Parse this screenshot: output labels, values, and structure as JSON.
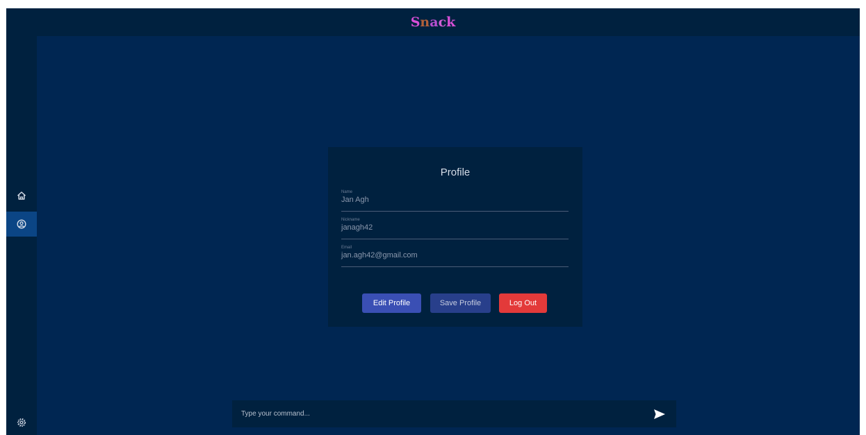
{
  "app": {
    "title_letters": [
      {
        "char": "S",
        "color": "#d94fd8"
      },
      {
        "char": "n",
        "color": "#b0603a"
      },
      {
        "char": "a",
        "color": "#b84fd0"
      },
      {
        "char": "c",
        "color": "#d15fd6"
      },
      {
        "char": "k",
        "color": "#d94fd8"
      }
    ]
  },
  "sidebar": {
    "items": [
      {
        "icon": "home-icon",
        "active": false
      },
      {
        "icon": "profile-icon",
        "active": true
      }
    ],
    "bottom_icon": "settings-icon"
  },
  "profile": {
    "title": "Profile",
    "fields": [
      {
        "label": "Name",
        "value": "Jan Agh"
      },
      {
        "label": "Nickname",
        "value": "janagh42"
      },
      {
        "label": "Email",
        "value": "jan.agh42@gmail.com"
      }
    ],
    "buttons": {
      "edit": "Edit Profile",
      "save": "Save Profile",
      "logout": "Log Out"
    }
  },
  "command": {
    "placeholder": "Type your command...",
    "send_icon": "send-icon"
  },
  "colors": {
    "background": "#002652",
    "panel": "#00213f",
    "active_nav": "#0b4585",
    "edit_button": "#3a4fb4",
    "save_button": "#283f8b",
    "logout_button": "#e33a3a"
  }
}
